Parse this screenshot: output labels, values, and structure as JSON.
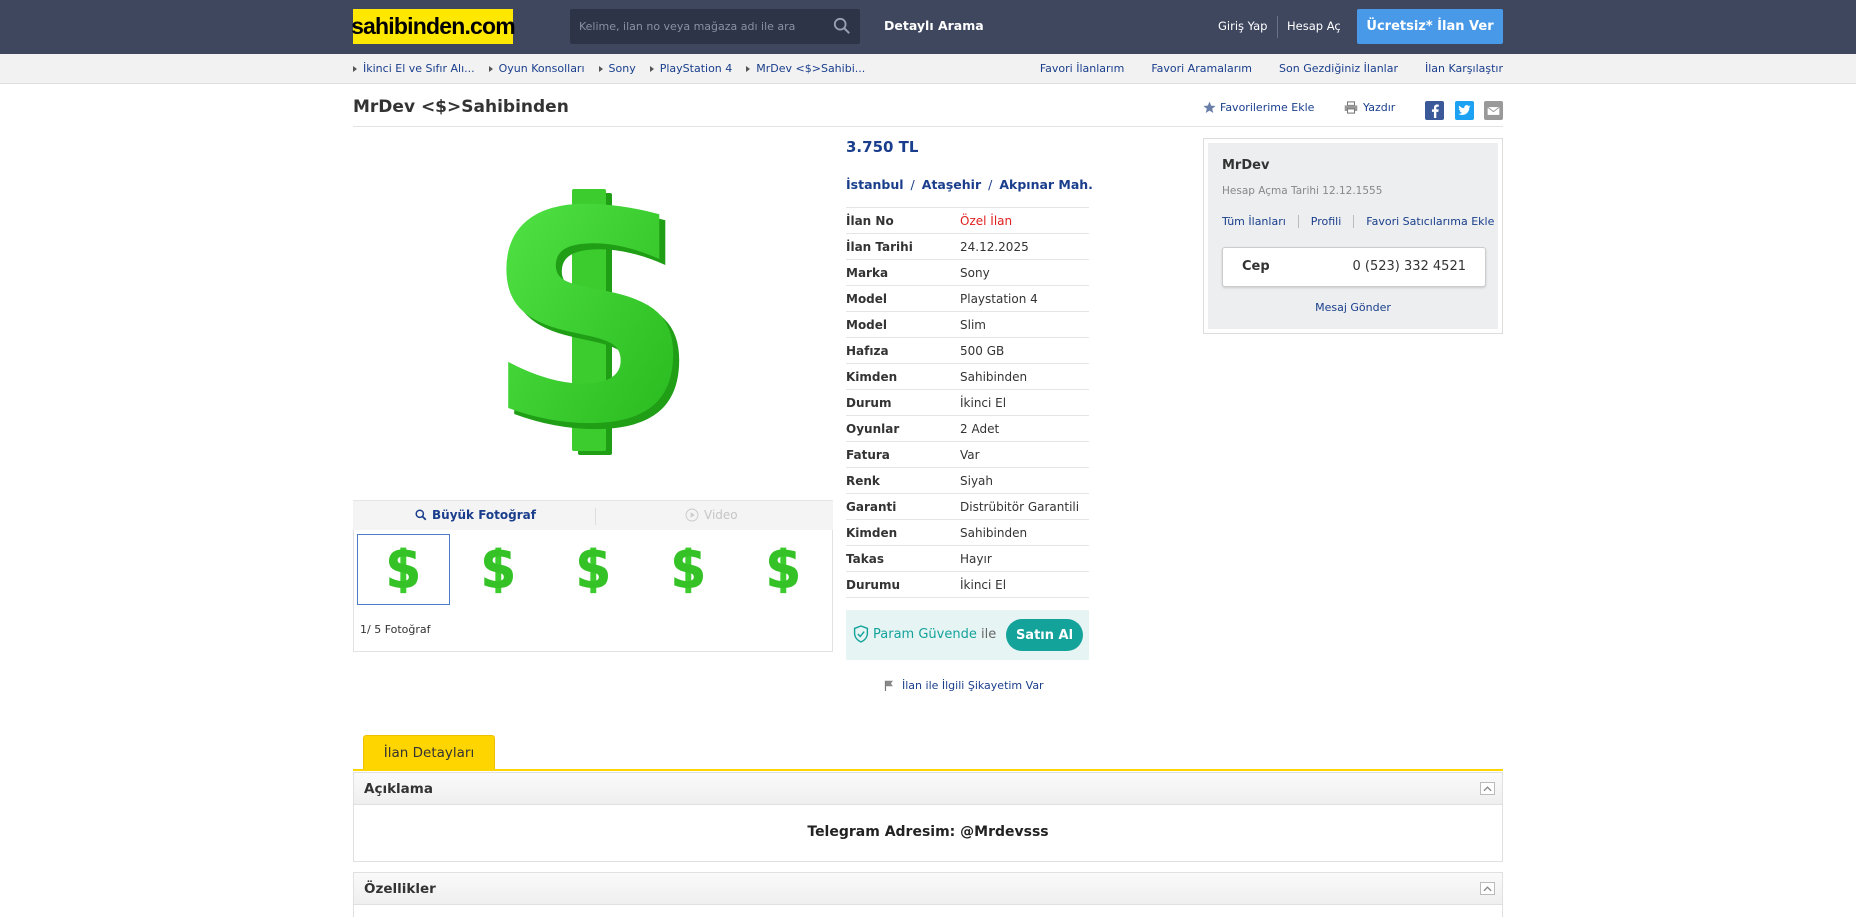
{
  "header": {
    "logo": "sahibinden.com",
    "search_placeholder": "Kelime, ilan no veya mağaza adı ile ara",
    "detayli_arama": "Detaylı Arama",
    "giris_yap": "Giriş Yap",
    "hesap_ac": "Hesap Aç",
    "ilan_ver": "Ücretsiz* İlan Ver"
  },
  "breadcrumb": [
    "İkinci El ve Sıfır Alı...",
    "Oyun Konsolları",
    "Sony",
    "PlayStation 4",
    "MrDev <$>Sahibi..."
  ],
  "top_links": [
    "Favori İlanlarım",
    "Favori Aramalarım",
    "Son Gezdiğiniz İlanlar",
    "İlan Karşılaştır"
  ],
  "listing": {
    "title": "MrDev <$>Sahibinden",
    "favorite": "Favorilerime Ekle",
    "print": "Yazdır",
    "price": "3.750 TL",
    "location": [
      "İstanbul",
      "Ataşehir",
      "Akpınar Mah."
    ],
    "details": [
      {
        "k": "İlan No",
        "v": "Özel İlan"
      },
      {
        "k": "İlan Tarihi",
        "v": "24.12.2025"
      },
      {
        "k": "Marka",
        "v": "Sony"
      },
      {
        "k": "Model",
        "v": "Playstation 4"
      },
      {
        "k": "Model",
        "v": "Slim"
      },
      {
        "k": "Hafıza",
        "v": "500 GB"
      },
      {
        "k": "Kimden",
        "v": "Sahibinden"
      },
      {
        "k": "Durum",
        "v": "İkinci El"
      },
      {
        "k": "Oyunlar",
        "v": "2 Adet"
      },
      {
        "k": "Fatura",
        "v": "Var"
      },
      {
        "k": "Renk",
        "v": "Siyah"
      },
      {
        "k": "Garanti",
        "v": "Distrübitör Garantili"
      },
      {
        "k": "Kimden",
        "v": "Sahibinden"
      },
      {
        "k": "Takas",
        "v": "Hayır"
      },
      {
        "k": "Durumu",
        "v": "İkinci El"
      }
    ],
    "param_guvende": "Param Güvende",
    "ile": "ile",
    "satin_al": "Satın Al",
    "sikayet": "İlan ile İlgili Şikayetim Var"
  },
  "gallery": {
    "buyuk_foto": "Büyük Fotoğraf",
    "video": "Video",
    "photo_count": "1/ 5 Fotoğraf"
  },
  "seller": {
    "name": "MrDev",
    "since": "Hesap Açma Tarihi 12.12.1555",
    "links": [
      "Tüm İlanları",
      "Profili",
      "Favori Satıcılarıma Ekle"
    ],
    "phone_label": "Cep",
    "phone": "0 (523) 332 4521",
    "message": "Mesaj Gönder"
  },
  "tabs": {
    "ilan_detaylari": "İlan Detayları"
  },
  "sections": {
    "aciklama": "Açıklama",
    "description": "Telegram Adresim: @Mrdevsss",
    "ozellikler": "Özellikler"
  },
  "colors": {
    "header_bg": "#3f475f",
    "logo_bg": "#ffe800",
    "accent_blue": "#489ae9",
    "link": "#1a3e8c",
    "tab_yellow": "#ffd500",
    "param_green": "#14a39b",
    "dollar_green": "#3dcc2e"
  }
}
